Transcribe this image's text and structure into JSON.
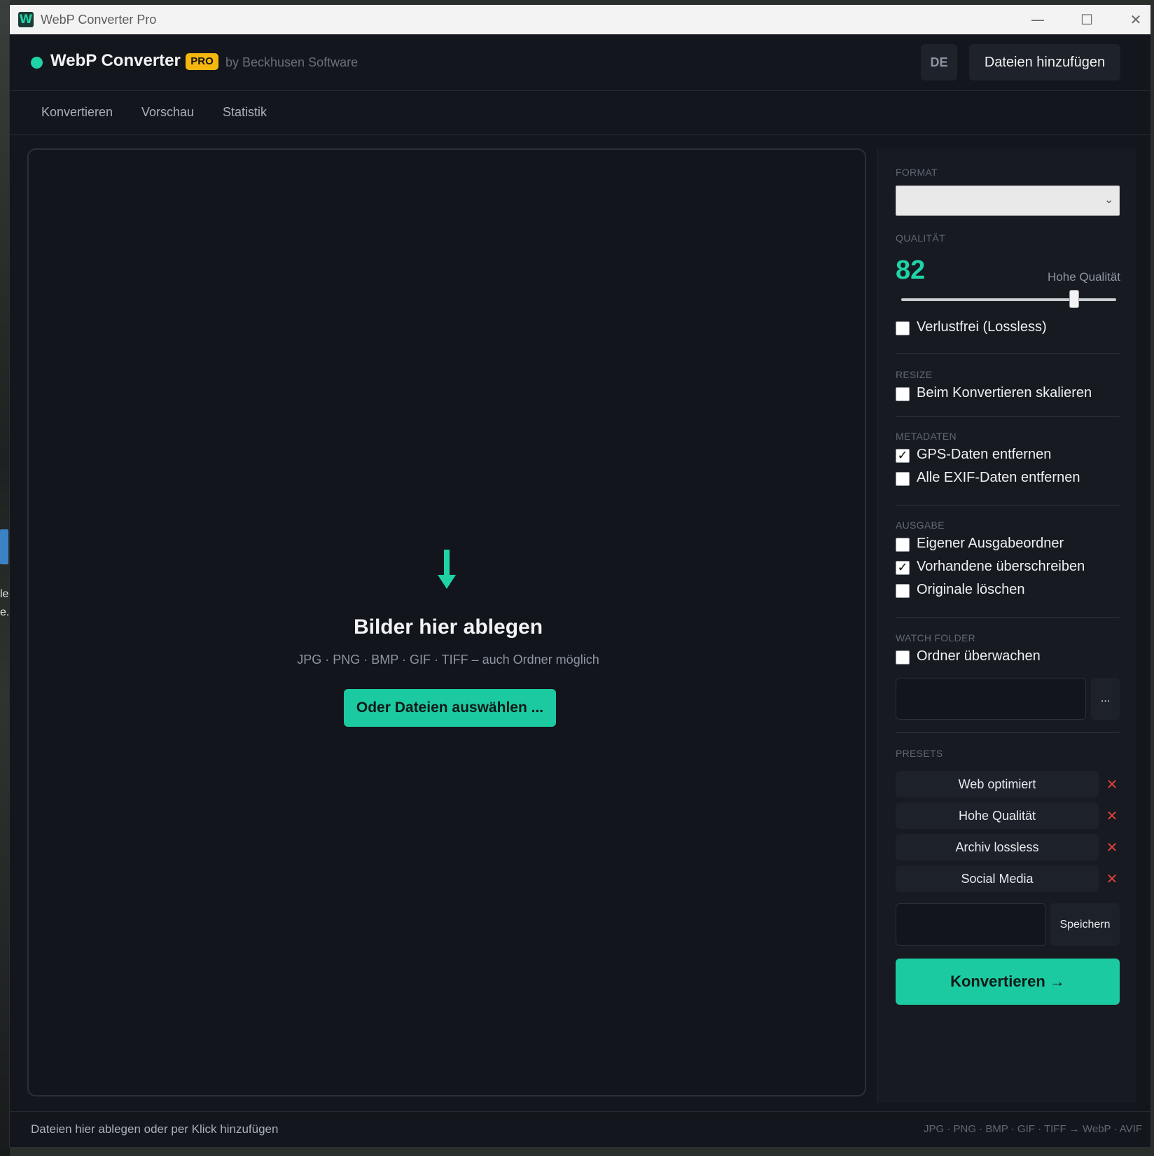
{
  "window": {
    "title": "WebP Converter Pro",
    "controls": {
      "minimize": "—",
      "maximize": "☐",
      "close": "✕"
    }
  },
  "desktop": {
    "text_top": "lel",
    "text_bottom": "e.v"
  },
  "header": {
    "brand": "WebP Converter",
    "badge": "PRO",
    "byline": "by Beckhusen Software",
    "lang_button": "DE",
    "add_files_button": "Dateien hinzufügen"
  },
  "tabs": [
    "Konvertieren",
    "Vorschau",
    "Statistik"
  ],
  "dropzone": {
    "icon": "arrow-down-icon",
    "title": "Bilder hier ablegen",
    "subtitle": "JPG · PNG · BMP · GIF · TIFF – auch Ordner möglich",
    "choose_button": "Oder Dateien auswählen ..."
  },
  "settings": {
    "format": {
      "label": "FORMAT",
      "value": ""
    },
    "quality": {
      "label": "QUALITÄT",
      "value": "82",
      "description": "Hohe Qualität",
      "slider_level": 0.82,
      "lossless_label": "Verlustfrei (Lossless)",
      "lossless_checked": false
    },
    "resize": {
      "label": "RESIZE",
      "option": "Beim Konvertieren skalieren",
      "checked": false
    },
    "metadata": {
      "label": "METADATEN",
      "options": [
        {
          "label": "GPS-Daten entfernen",
          "checked": true
        },
        {
          "label": "Alle EXIF-Daten entfernen",
          "checked": false
        }
      ]
    },
    "output": {
      "label": "AUSGABE",
      "options": [
        {
          "label": "Eigener Ausgabeordner",
          "checked": false
        },
        {
          "label": "Vorhandene überschreiben",
          "checked": true
        },
        {
          "label": "Originale löschen",
          "checked": false
        }
      ]
    },
    "watch_folder": {
      "label": "WATCH FOLDER",
      "option": "Ordner überwachen",
      "checked": false,
      "path_value": "",
      "browse_button": "..."
    },
    "presets": {
      "label": "PRESETS",
      "items": [
        "Web optimiert",
        "Hohe Qualität",
        "Archiv lossless",
        "Social Media"
      ],
      "delete_icon": "close-icon",
      "name_value": "",
      "save_button": "Speichern"
    },
    "convert_button": "Konvertieren →"
  },
  "footer": {
    "status": "Dateien hier ablegen oder per Klick hinzufügen",
    "formats": "JPG · PNG · BMP · GIF · TIFF → WebP · AVIF"
  },
  "colors": {
    "accent": "#1ccaa1",
    "badge": "#f5b70e",
    "background": "#13161c",
    "panel": "#171a21",
    "danger": "#e0413c"
  }
}
